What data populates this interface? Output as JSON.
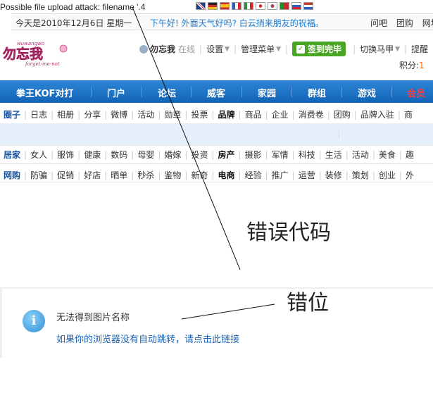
{
  "error_banner": "Possible file upload attack: filename '.4",
  "flags": [
    "#1f3f8f",
    "#222222",
    "#d8282f",
    "#2d5fc4",
    "#2f8e3a",
    "#ffffff",
    "#ffffff",
    "#2a8a2a",
    "#e8e8f4",
    "#c83a2a"
  ],
  "topbar": {
    "date": "今天是2010年12月6日  星期一",
    "greeting": "下午好! 外面天气好吗? 白云捎来朋友的祝福。",
    "links": [
      "问吧",
      "团购",
      "网址"
    ]
  },
  "logo": {
    "main": "勿忘我",
    "sub": "wuwangwo",
    "tag": "forget-me-not"
  },
  "userbar": {
    "username": "勿忘我",
    "status": "在线",
    "settings": "设置",
    "admin_menu": "管理菜单",
    "sign_button": "签到完毕",
    "switch_label": "切换马甲",
    "remind": "提醒"
  },
  "score": {
    "label": "积分:",
    "value": "1"
  },
  "nav": [
    "拳王KOF对打",
    "门户",
    "论坛",
    "威客",
    "家园",
    "群组",
    "游戏",
    "会员"
  ],
  "row1": [
    "圈子",
    "日志",
    "相册",
    "分享",
    "微博",
    "活动",
    "勋章",
    "投票",
    "品牌",
    "商品",
    "企业",
    "消费卷",
    "团购",
    "品牌入驻",
    "商"
  ],
  "row2": [
    "居家",
    "女人",
    "服饰",
    "健康",
    "数码",
    "母婴",
    "婚嫁",
    "投资",
    "房产",
    "摄影",
    "军情",
    "科技",
    "生活",
    "活动",
    "美食",
    "趣"
  ],
  "row3": [
    "网购",
    "防骗",
    "促销",
    "好店",
    "晒单",
    "秒杀",
    "鉴物",
    "新奇",
    "电商",
    "经验",
    "推广",
    "运营",
    "装修",
    "策划",
    "创业",
    "外"
  ],
  "annotations": {
    "error_code": "错误代码",
    "misaligned": "错位"
  },
  "notice": {
    "title": "无法得到图片名称",
    "link": "如果你的浏览器没有自动跳转，请点击此链接"
  }
}
